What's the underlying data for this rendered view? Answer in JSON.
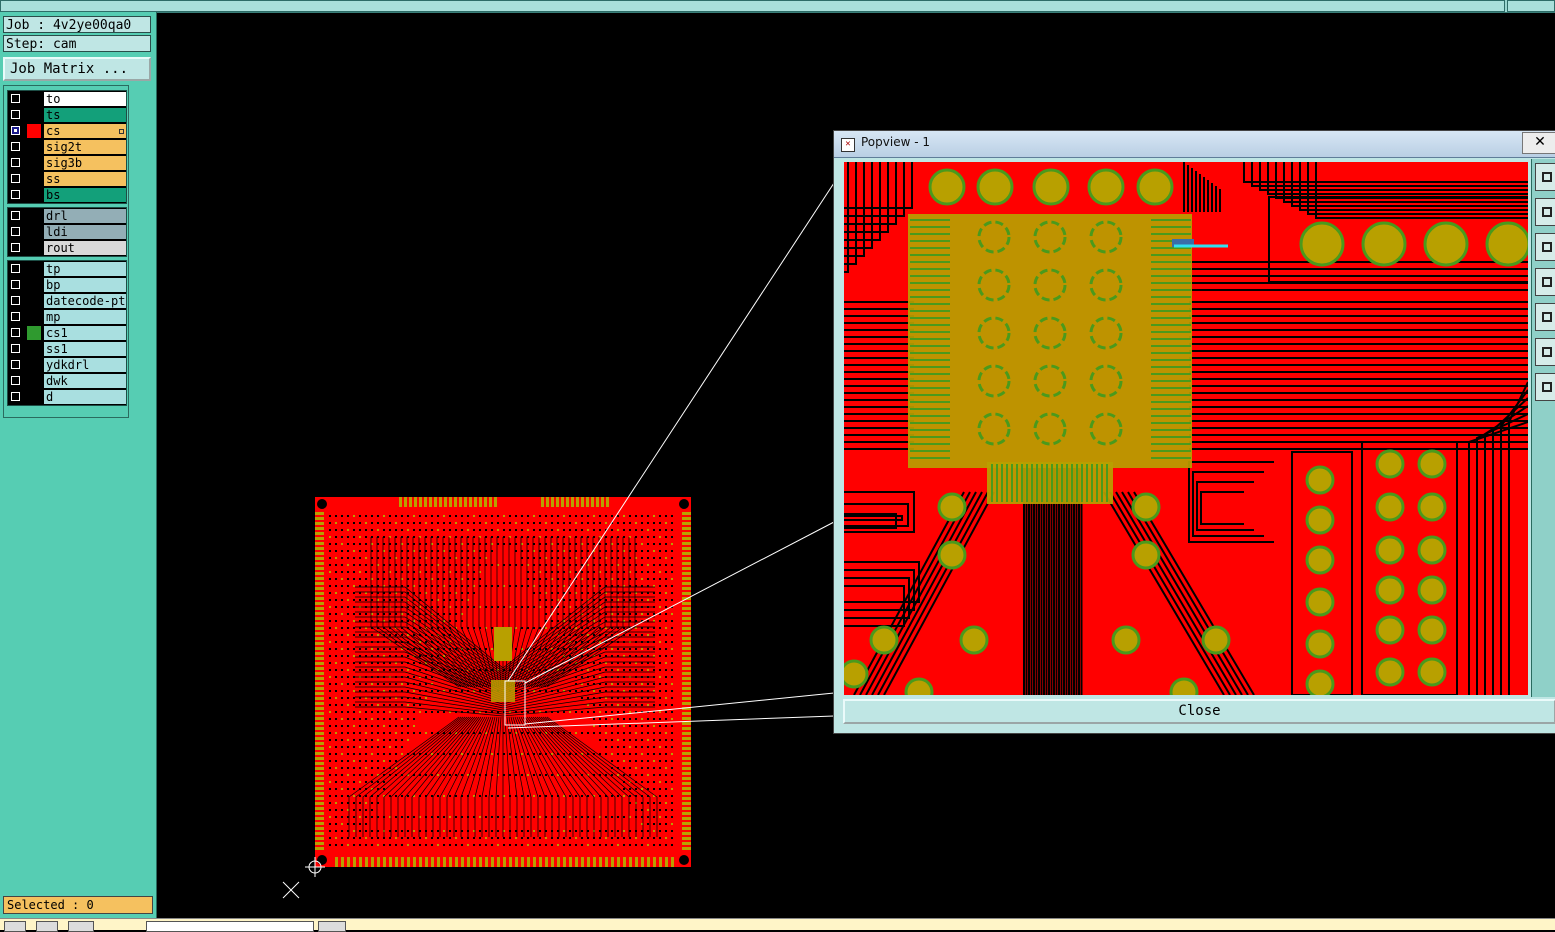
{
  "job_label": "Job : 4v2ye00qa0",
  "step_label": "Step: cam",
  "job_matrix_button": "Job Matrix ...",
  "layer_groups": [
    [
      {
        "name": "to",
        "color": "#ffffff",
        "swatch": "#000000",
        "checked": false
      },
      {
        "name": "ts",
        "color": "#13a07a",
        "swatch": "#000000",
        "checked": false
      },
      {
        "name": "cs",
        "color": "#f5c15f",
        "swatch": "#ff0000",
        "checked": true,
        "marker": true
      },
      {
        "name": "sig2t",
        "color": "#f5c15f",
        "swatch": "#000000",
        "checked": false
      },
      {
        "name": "sig3b",
        "color": "#f5c15f",
        "swatch": "#000000",
        "checked": false
      },
      {
        "name": "ss",
        "color": "#f5c15f",
        "swatch": "#000000",
        "checked": false
      },
      {
        "name": "bs",
        "color": "#13a07a",
        "swatch": "#000000",
        "checked": false
      }
    ],
    [
      {
        "name": "drl",
        "color": "#93aeb6",
        "swatch": "#000000",
        "checked": false
      },
      {
        "name": "ldi",
        "color": "#93aeb6",
        "swatch": "#000000",
        "checked": false
      },
      {
        "name": "rout",
        "color": "#d9d9d9",
        "swatch": "#000000",
        "checked": false
      }
    ],
    [
      {
        "name": "tp",
        "color": "#a9dfe0",
        "swatch": "#000000",
        "checked": false
      },
      {
        "name": "bp",
        "color": "#a9dfe0",
        "swatch": "#000000",
        "checked": false
      },
      {
        "name": "datecode-pt",
        "color": "#a9dfe0",
        "swatch": "#000000",
        "checked": false
      },
      {
        "name": "mp",
        "color": "#a9dfe0",
        "swatch": "#000000",
        "checked": false
      },
      {
        "name": "cs1",
        "color": "#a9dfe0",
        "swatch": "#2f9a2f",
        "checked": false
      },
      {
        "name": "ss1",
        "color": "#a9dfe0",
        "swatch": "#000000",
        "checked": false
      },
      {
        "name": "ydkdrl",
        "color": "#a9dfe0",
        "swatch": "#000000",
        "checked": false
      },
      {
        "name": "dwk",
        "color": "#a9dfe0",
        "swatch": "#000000",
        "checked": false
      },
      {
        "name": "d",
        "color": "#a9dfe0",
        "swatch": "#000000",
        "checked": false
      }
    ]
  ],
  "selected_label": "Selected : 0",
  "popview": {
    "title": "Popview - 1",
    "close_x": "✕",
    "close_button": "Close",
    "icon": "popview-window-icon"
  },
  "colors": {
    "copper": "#ff0000",
    "pad": "#b8a000",
    "trace_dark": "#000000",
    "panel": "#56cdb3"
  },
  "icons": [
    "crosshair-icon",
    "cursor-x-icon",
    "zoom-fit-icon",
    "zoom-in-icon",
    "zoom-out-icon",
    "pan-left-icon",
    "pan-right-icon",
    "zoom-area-icon",
    "zoom-home-icon"
  ]
}
